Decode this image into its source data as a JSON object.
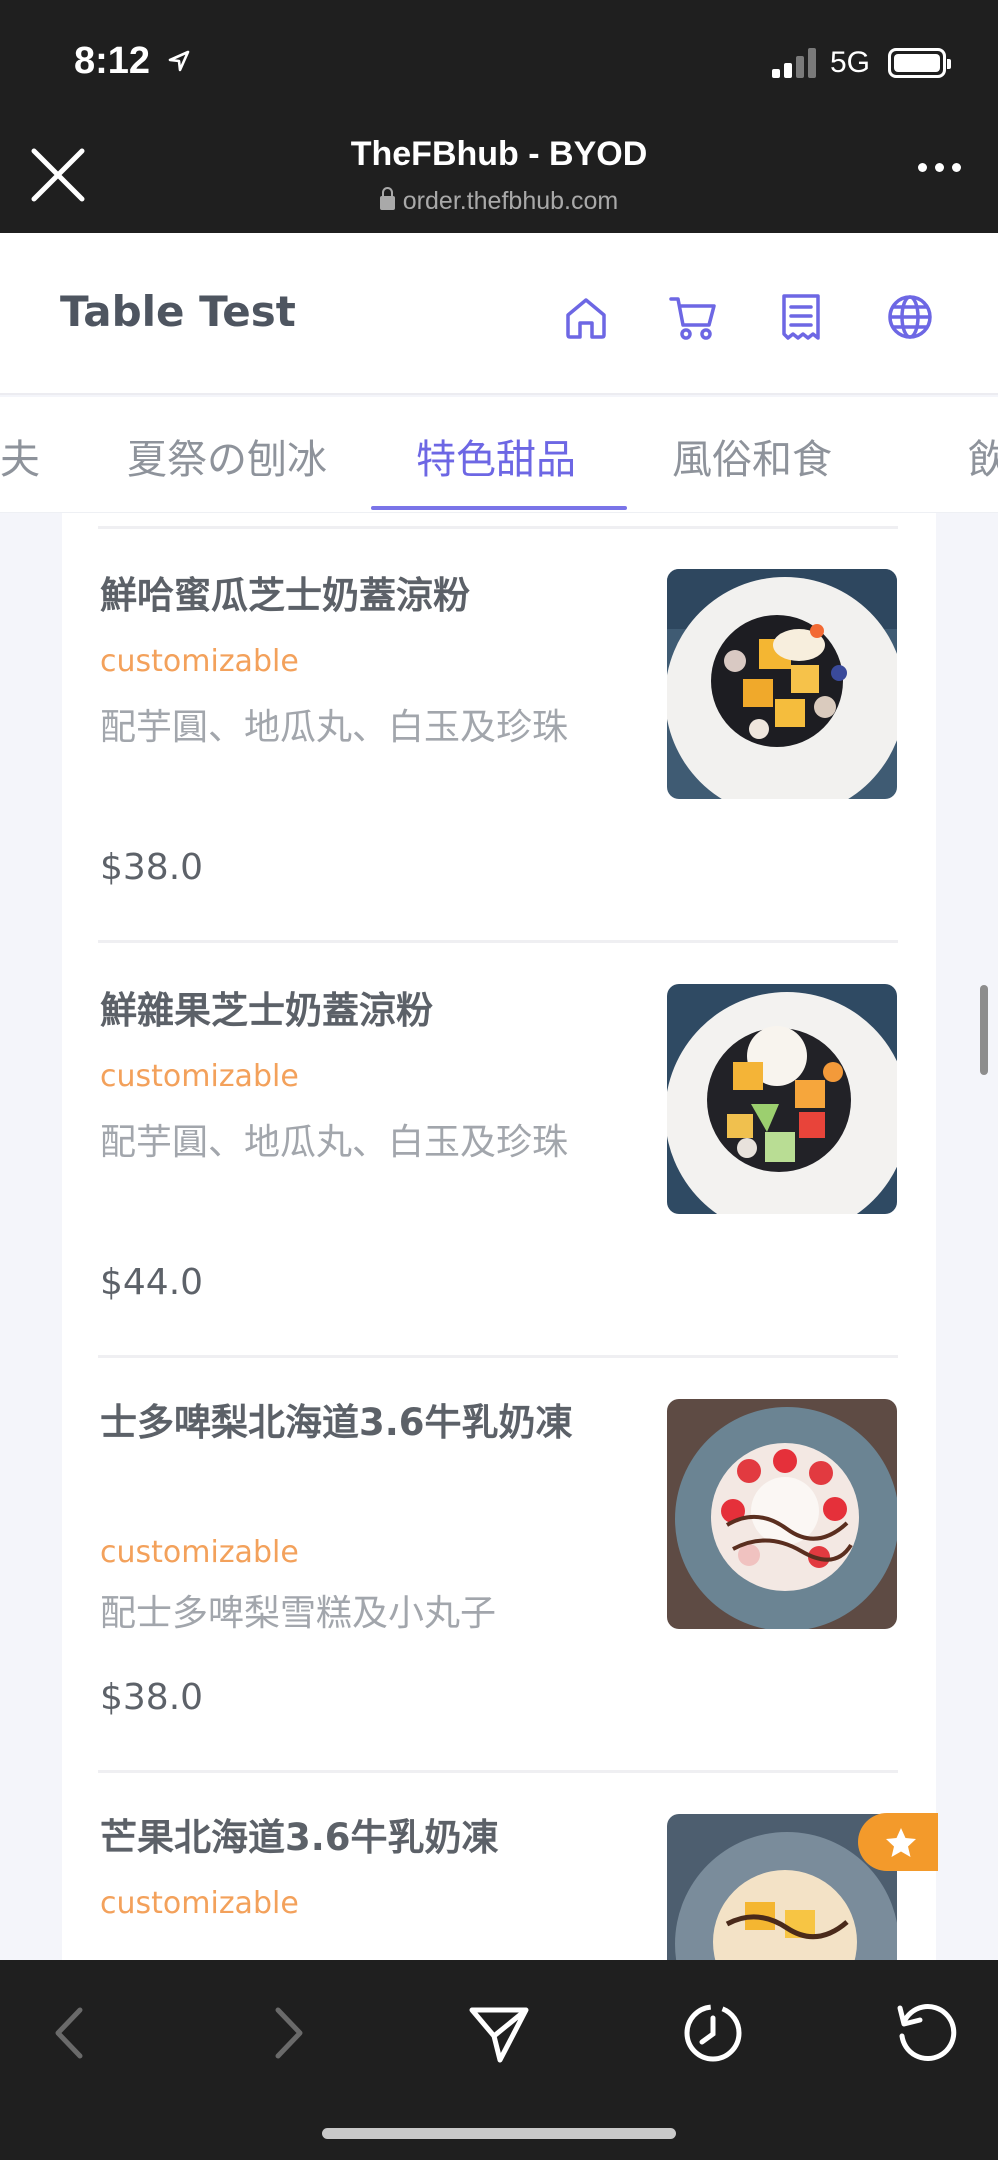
{
  "status_bar": {
    "time": "8:12",
    "network": "5G"
  },
  "browser": {
    "title": "TheFBhub - BYOD",
    "url": "order.thefbhub.com"
  },
  "header": {
    "title": "Table Test"
  },
  "tabs": [
    "夫",
    "夏祭の刨冰",
    "特色甜品",
    "風俗和食",
    "飲"
  ],
  "active_tab": "特色甜品",
  "items": [
    {
      "name": "鮮哈蜜瓜芝士奶蓋涼粉",
      "tag": "customizable",
      "desc": "配芋圓、地瓜丸、白玉及珍珠",
      "price": "$38.0"
    },
    {
      "name": "鮮雜果芝士奶蓋涼粉",
      "tag": "customizable",
      "desc": "配芋圓、地瓜丸、白玉及珍珠",
      "price": "$44.0"
    },
    {
      "name": "士多啤梨北海道3.6牛乳奶凍",
      "tag": "customizable",
      "desc": "配士多啤梨雪糕及小丸子",
      "price": "$38.0"
    },
    {
      "name": "芒果北海道3.6牛乳奶凍",
      "tag": "customizable",
      "desc": "",
      "price": ""
    }
  ],
  "colors": {
    "accent": "#6d67e4",
    "tag": "#f3a15b",
    "badge": "#f39a2b"
  }
}
